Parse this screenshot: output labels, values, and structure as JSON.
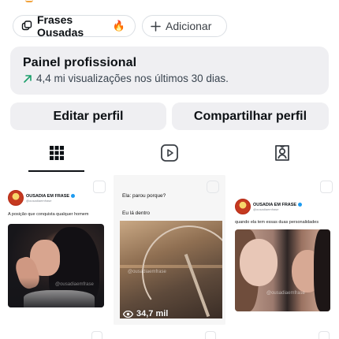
{
  "highlights": {
    "highlight_label": "Frases Ousadas",
    "highlight_emoji": "🔥",
    "add_label": "Adicionar"
  },
  "panel": {
    "title": "Painel profissional",
    "subtitle": "4,4 mi visualizações nos últimos 30 dias."
  },
  "actions": {
    "edit_label": "Editar perfil",
    "share_label": "Compartilhar perfil"
  },
  "tabs": [
    {
      "icon": "grid-icon",
      "active": true
    },
    {
      "icon": "reels-icon",
      "active": false
    },
    {
      "icon": "tagged-icon",
      "active": false
    }
  ],
  "posts": [
    {
      "account_name": "OUSADIA EM FRASE",
      "account_handle": "@ousadiaemfrase",
      "caption": "A posição que conquista qualquer homem",
      "watermark": "@ousadiaemfrase"
    },
    {
      "line1": "Ela: parou porque?",
      "line2": "Eu lá dentro",
      "watermark": "@ousadiaemfrase",
      "views": "34,7 mil"
    },
    {
      "account_name": "OUSADIA EM FRASE",
      "account_handle": "@ousadiaemfrase",
      "caption": "quando ela tem essas duas personalidades",
      "watermark": "@ousadiaemfrase"
    }
  ],
  "colors": {
    "panel_bg": "#efeff2",
    "trend_arrow": "#1a9e6a",
    "text": "#0c1014"
  }
}
